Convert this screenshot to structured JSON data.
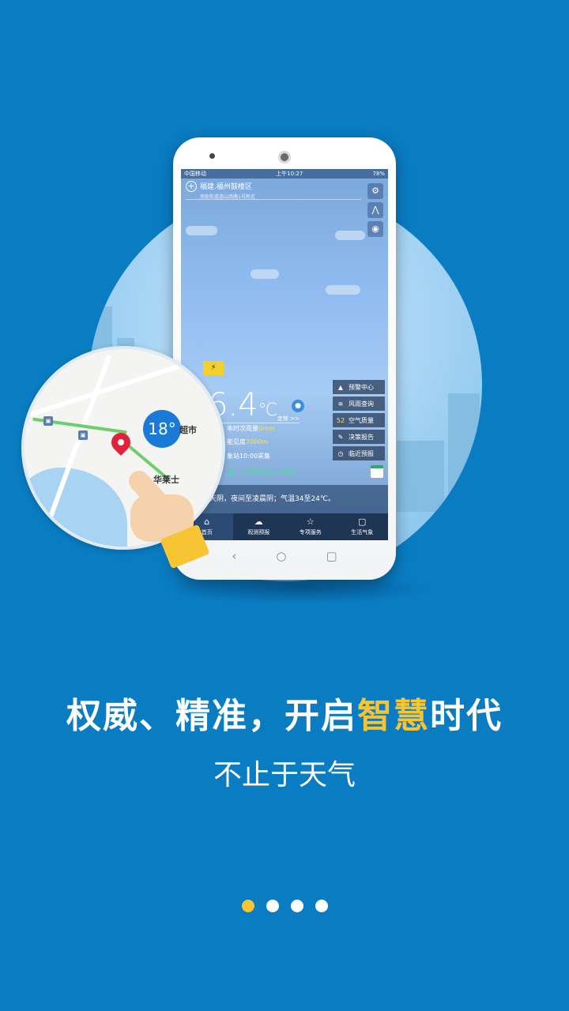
{
  "phone_screen": {
    "status_bar": {
      "carrier": "中国移动",
      "time": "上午10:27",
      "battery": "78%"
    },
    "location": {
      "title": "福建.福州鼓楼区",
      "address": "南街街道道山西路1号附近"
    },
    "side_icons": [
      "settings-icon",
      "share-icon",
      "camera-icon"
    ],
    "temperature": {
      "value": "6.4",
      "unit": "℃"
    },
    "trend_label": "走势 >>",
    "info": {
      "rain_label": "本时次雨量",
      "rain_value": "0mm",
      "visibility_label": "能见度",
      "visibility_value": "7000m",
      "station": "象站10:00采集"
    },
    "date_line": "期二  农历四月初八  小满节气",
    "menu": [
      {
        "icon": "warning-icon",
        "label": "预警中心"
      },
      {
        "icon": "wind-rain-icon",
        "label": "风雨查询"
      },
      {
        "icon": "aqi",
        "value": "52",
        "label": "空气质量"
      },
      {
        "icon": "report-icon",
        "label": "决策报告"
      },
      {
        "icon": "clock-icon",
        "label": "临近预报"
      }
    ],
    "forecast": "天阴，夜间至凌晨阴；气温34至24℃。",
    "bottom_nav": [
      "首页",
      "观测预报",
      "专项服务",
      "生活气象"
    ]
  },
  "map": {
    "temp_badge": "18°",
    "labels": [
      "超市",
      "华莱士"
    ]
  },
  "headline": {
    "part1": "权威、精准，开启",
    "accent": "智慧",
    "part2": "时代"
  },
  "subline": "不止于天气",
  "pager": {
    "total": 4,
    "active_index": 0
  },
  "colors": {
    "background": "#0a7cc2",
    "accent": "#f7c533"
  }
}
